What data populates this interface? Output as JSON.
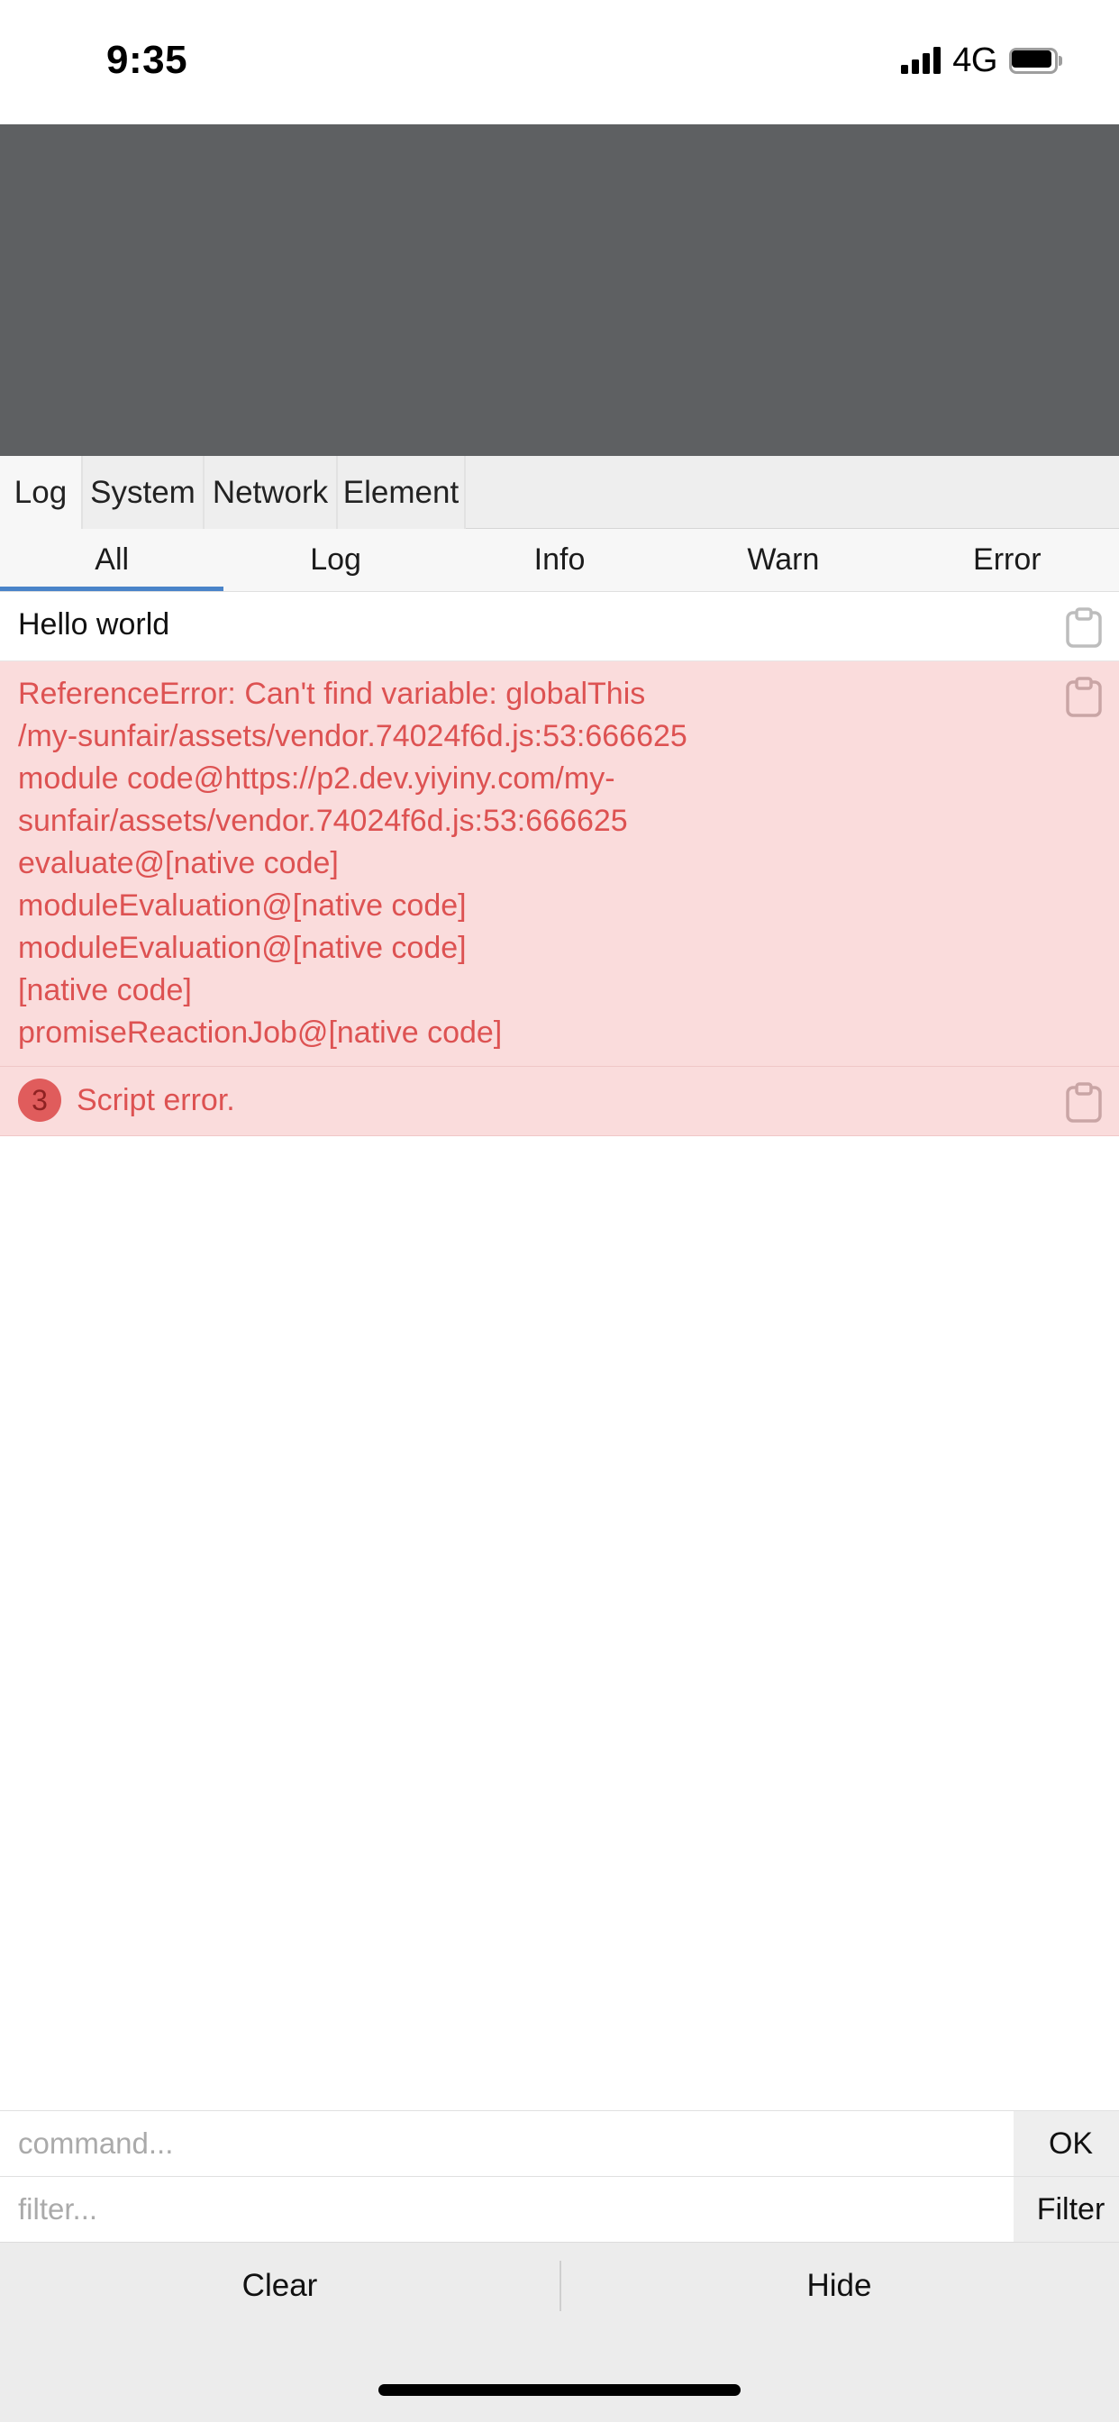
{
  "status_bar": {
    "time": "9:35",
    "network_label": "4G",
    "signal_icon": "signal-bars-icon",
    "battery_icon": "battery-icon"
  },
  "webview": {
    "placeholder_region": ""
  },
  "panel_tabs": [
    {
      "label": "Log",
      "active": true
    },
    {
      "label": "System",
      "active": false
    },
    {
      "label": "Network",
      "active": false
    },
    {
      "label": "Element",
      "active": false
    }
  ],
  "level_tabs": [
    {
      "label": "All",
      "active": true
    },
    {
      "label": "Log",
      "active": false
    },
    {
      "label": "Info",
      "active": false
    },
    {
      "label": "Warn",
      "active": false
    },
    {
      "label": "Error",
      "active": false
    }
  ],
  "log_entries": [
    {
      "level": "log",
      "count": "",
      "lines": [
        "Hello world"
      ],
      "copy_icon": "clipboard-icon"
    },
    {
      "level": "error",
      "count": "",
      "lines": [
        "ReferenceError: Can't find variable: globalThis",
        "/my-sunfair/assets/vendor.74024f6d.js:53:666625",
        "module code@https://p2.dev.yiyiny.com/my-sunfair/assets/vendor.74024f6d.js:53:666625",
        "evaluate@[native code]",
        "moduleEvaluation@[native code]",
        "moduleEvaluation@[native code]",
        "[native code]",
        "promiseReactionJob@[native code]"
      ],
      "copy_icon": "clipboard-icon"
    },
    {
      "level": "error",
      "count": "3",
      "lines": [
        "Script error."
      ],
      "copy_icon": "clipboard-icon"
    }
  ],
  "command_bar": {
    "placeholder": "command...",
    "value": "",
    "button_label": "OK"
  },
  "filter_bar": {
    "placeholder": "filter...",
    "value": "",
    "button_label": "Filter"
  },
  "bottom_bar": {
    "clear_label": "Clear",
    "hide_label": "Hide"
  },
  "colors": {
    "accent": "#4a84c9",
    "error_text": "#dd5252",
    "error_background": "#fadcdc",
    "badge_background": "#e05c5c",
    "webview_background": "#5e6062",
    "toolbar_background": "#ececec"
  }
}
